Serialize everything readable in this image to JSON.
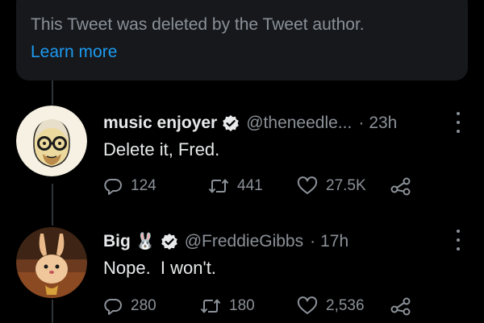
{
  "deleted_notice": {
    "message": "This Tweet was deleted by the Tweet author.",
    "link": "Learn more"
  },
  "tweets": [
    {
      "name": "music enjoyer",
      "emoji": "",
      "verified": true,
      "handle": "@theneedle...",
      "separator": "·",
      "time": "23h",
      "text": "Delete it, Fred.",
      "replies": "124",
      "retweets": "441",
      "likes": "27.5K"
    },
    {
      "name": "Big",
      "emoji": "🐰",
      "verified": true,
      "handle": "@FreddieGibbs",
      "separator": "·",
      "time": "17h",
      "text": "Nope.  I won't.",
      "replies": "280",
      "retweets": "180",
      "likes": "2,536"
    }
  ],
  "icons": {
    "reply": "reply-icon",
    "retweet": "retweet-icon",
    "like": "heart-icon",
    "share": "share-icon",
    "more": "more-icon",
    "verified": "verified-badge-icon"
  },
  "colors": {
    "background": "#000000",
    "card": "#16181c",
    "text": "#e7e9ea",
    "muted": "#8b9198",
    "link": "#1d9bf0"
  }
}
